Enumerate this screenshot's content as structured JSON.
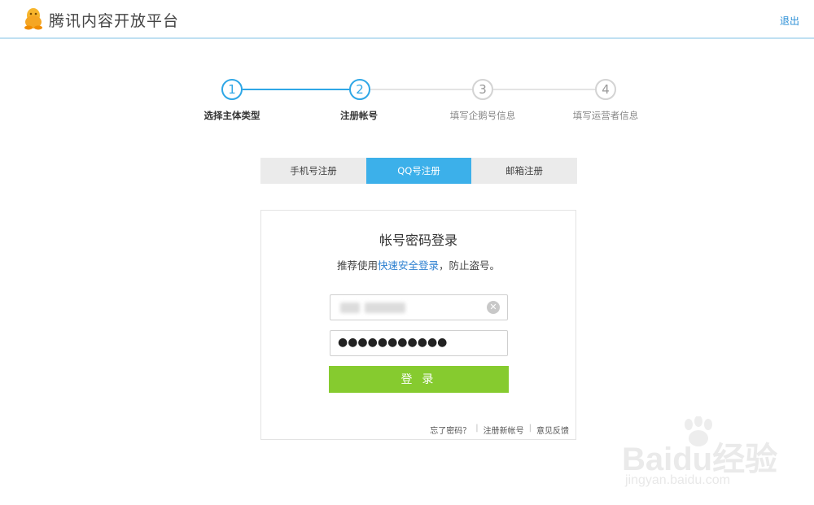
{
  "header": {
    "title": "腾讯内容开放平台",
    "logout_label": "退出"
  },
  "steps": [
    {
      "number": "1",
      "label": "选择主体类型",
      "state": "active"
    },
    {
      "number": "2",
      "label": "注册帐号",
      "state": "active"
    },
    {
      "number": "3",
      "label": "填写企鹅号信息",
      "state": "inactive"
    },
    {
      "number": "4",
      "label": "填写运营者信息",
      "state": "inactive"
    }
  ],
  "tabs": [
    {
      "label": "手机号注册",
      "active": false
    },
    {
      "label": "QQ号注册",
      "active": true
    },
    {
      "label": "邮箱注册",
      "active": false
    }
  ],
  "login": {
    "title": "帐号密码登录",
    "subtitle_prefix": "推荐使用",
    "subtitle_link": "快速安全登录",
    "subtitle_suffix": "，防止盗号。",
    "password_mask": "●●●●●●●●●●●",
    "submit_label": "登 录",
    "links": {
      "forgot": "忘了密码？",
      "register": "注册新帐号",
      "feedback": "意见反馈",
      "separator": "|"
    }
  },
  "watermark": {
    "brand": "Baidu经验",
    "url": "jingyan.baidu.com"
  },
  "colors": {
    "accent": "#2fa7e6",
    "tab_active": "#3cb0ea",
    "submit": "#86cb2f",
    "link": "#2b7fd0"
  }
}
